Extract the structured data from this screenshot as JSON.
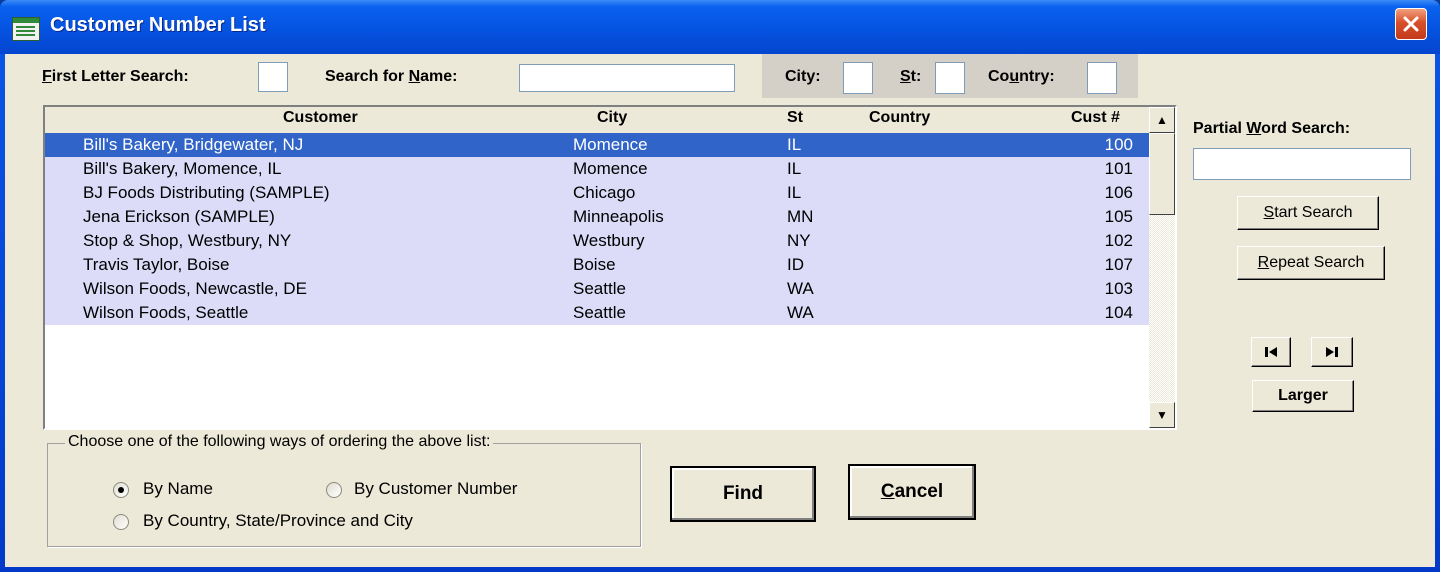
{
  "window": {
    "title": "Customer Number List",
    "close_symbol": "✕"
  },
  "search_bar": {
    "first_letter_label_pre": "",
    "first_letter_label_u": "F",
    "first_letter_label_post": "irst Letter Search:",
    "first_letter_value": "",
    "name_label_pre": "Search for ",
    "name_label_u": "N",
    "name_label_post": "ame:",
    "name_value": "",
    "city_label": "City:",
    "city_value": "",
    "st_label_u": "S",
    "st_label_post": "t:",
    "st_value": "",
    "country_label_pre": "Co",
    "country_label_u": "u",
    "country_label_post": "ntry:",
    "country_value": ""
  },
  "list": {
    "columns": {
      "customer": "Customer",
      "city": "City",
      "st": "St",
      "country": "Country",
      "cust_num": "Cust #"
    },
    "rows": [
      {
        "customer": "Bill's Bakery, Bridgewater, NJ",
        "city": "Momence",
        "st": "IL",
        "country": "",
        "num": "100",
        "selected": true
      },
      {
        "customer": "Bill's Bakery, Momence, IL",
        "city": "Momence",
        "st": "IL",
        "country": "",
        "num": "101"
      },
      {
        "customer": "BJ Foods Distributing (SAMPLE)",
        "city": "Chicago",
        "st": "IL",
        "country": "",
        "num": "106"
      },
      {
        "customer": "Jena Erickson (SAMPLE)",
        "city": "Minneapolis",
        "st": "MN",
        "country": "",
        "num": "105"
      },
      {
        "customer": "Stop & Shop, Westbury, NY",
        "city": "Westbury",
        "st": "NY",
        "country": "",
        "num": "102"
      },
      {
        "customer": "Travis Taylor, Boise",
        "city": "Boise",
        "st": "ID",
        "country": "",
        "num": "107"
      },
      {
        "customer": "Wilson Foods, Newcastle, DE",
        "city": "Seattle",
        "st": "WA",
        "country": "",
        "num": "103"
      },
      {
        "customer": "Wilson Foods, Seattle",
        "city": "Seattle",
        "st": "WA",
        "country": "",
        "num": "104"
      }
    ],
    "scroll_up_icon": "▲",
    "scroll_down_icon": "▼"
  },
  "right_panel": {
    "partial_label_pre": "Partial ",
    "partial_label_u": "W",
    "partial_label_post": "ord Search:",
    "partial_value": "",
    "start_u": "S",
    "start_post": "tart Search",
    "repeat_u": "R",
    "repeat_post": "epeat Search",
    "first_record_icon": "⏮",
    "last_record_icon": "⏭",
    "larger_label": "Larger"
  },
  "ordering": {
    "legend": "Choose one of the following ways of ordering the above list:",
    "options": [
      {
        "label": "By Name",
        "checked": true
      },
      {
        "label": "By Customer Number",
        "checked": false
      },
      {
        "label": "By Country, State/Province and City",
        "checked": false
      }
    ]
  },
  "actions": {
    "find_label": "Find",
    "cancel_u": "C",
    "cancel_post": "ancel"
  }
}
